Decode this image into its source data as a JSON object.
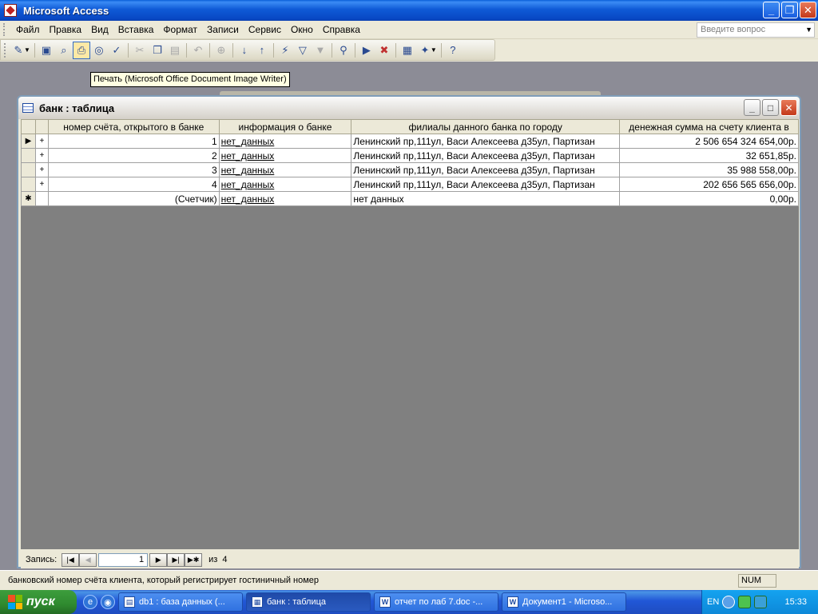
{
  "window": {
    "title": "Microsoft Access",
    "minimize": "_",
    "maximize": "❐",
    "close": "✕"
  },
  "menu": [
    "Файл",
    "Правка",
    "Вид",
    "Вставка",
    "Формат",
    "Записи",
    "Сервис",
    "Окно",
    "Справка"
  ],
  "ask": {
    "placeholder": "Введите вопрос"
  },
  "tooltip": "Печать (Microsoft Office Document Image Writer)",
  "toolbar_icons": [
    "design-view-icon",
    "save-icon",
    "search-icon",
    "print-icon",
    "print-preview-icon",
    "spelling-icon",
    "cut-icon",
    "copy-icon",
    "paste-icon",
    "undo-icon",
    "hyperlink-icon",
    "sort-ascending-icon",
    "sort-descending-icon",
    "filter-by-selection-icon",
    "filter-by-form-icon",
    "apply-filter-icon",
    "find-icon",
    "new-record-icon",
    "delete-record-icon",
    "database-window-icon",
    "new-object-icon",
    "help-icon"
  ],
  "child": {
    "title": "банк : таблица",
    "minimize": "_",
    "maximize": "□",
    "close": "✕"
  },
  "table": {
    "columns": [
      "номер счёта, открытого в банке",
      "информация о банке",
      "филиалы данного банка по городу",
      "денежная сумма на счету клиента в"
    ],
    "rows": [
      {
        "selector": "▶",
        "expand": "+",
        "id": "1",
        "info": "нет_данных",
        "branches": "Ленинский пр,111ул, Васи Алексеева д35ул, Партизан",
        "amount": "2 506 654 324 654,00р."
      },
      {
        "selector": "",
        "expand": "+",
        "id": "2",
        "info": "нет_данных",
        "branches": "Ленинский пр,111ул, Васи Алексеева д35ул, Партизан",
        "amount": "32 651,85р."
      },
      {
        "selector": "",
        "expand": "+",
        "id": "3",
        "info": "нет_данных",
        "branches": "Ленинский пр,111ул, Васи Алексеева д35ул, Партизан",
        "amount": "35 988 558,00р."
      },
      {
        "selector": "",
        "expand": "+",
        "id": "4",
        "info": "нет_данных",
        "branches": "Ленинский пр,111ул, Васи Алексеева д35ул, Партизан",
        "amount": "202 656 565 656,00р."
      }
    ],
    "new_row": {
      "selector": "✱",
      "id": "(Счетчик)",
      "info": "нет_данных",
      "branches": "нет данных",
      "amount": "0,00р."
    }
  },
  "navigator": {
    "label": "Запись:",
    "current": "1",
    "of_label": "из",
    "total": "4"
  },
  "status": {
    "message": "банковский номер счёта клиента, который регистрирует гостиничный номер",
    "num": "NUM"
  },
  "taskbar": {
    "start": "пуск",
    "tasks": [
      {
        "label": "db1 : база данных (...",
        "icon": "database-icon"
      },
      {
        "label": "банк : таблица",
        "icon": "table-icon",
        "active": true
      },
      {
        "label": "отчет по лаб 7.doc -...",
        "icon": "word-doc-icon"
      },
      {
        "label": "Документ1 - Microso...",
        "icon": "word-doc-icon"
      }
    ],
    "lang": "EN",
    "clock": "15:33"
  }
}
